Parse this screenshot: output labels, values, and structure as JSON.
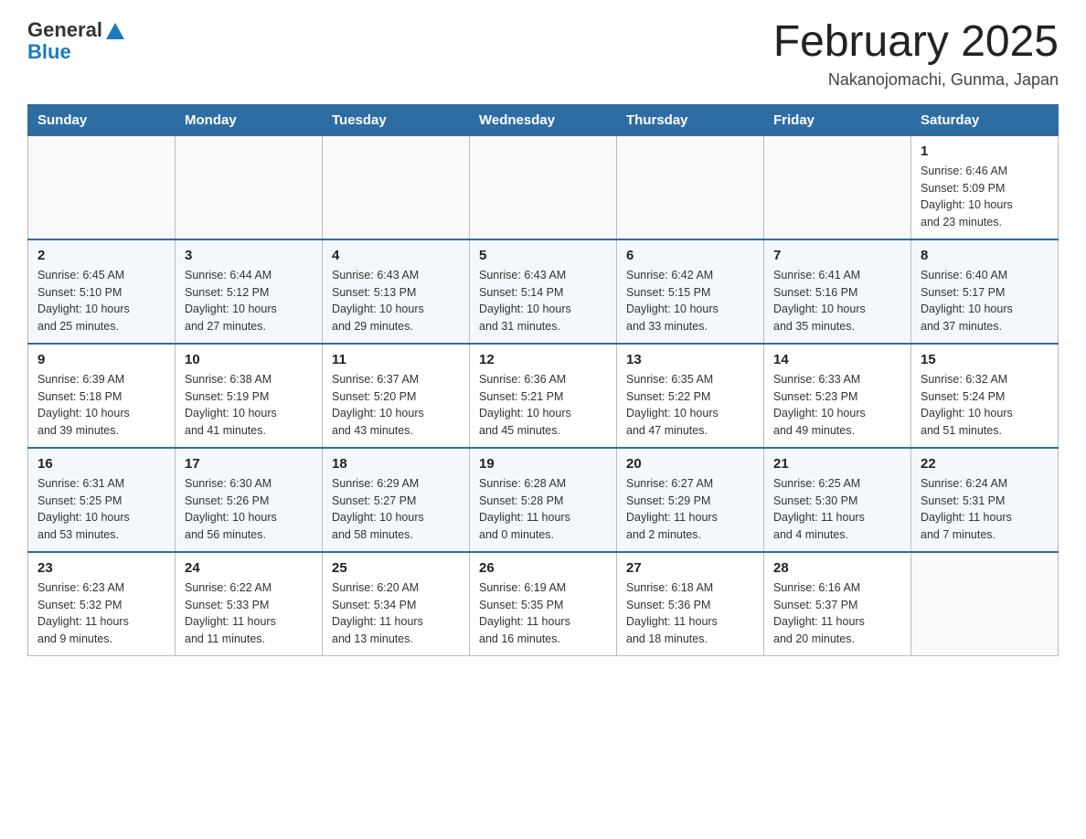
{
  "logo": {
    "general": "General",
    "blue": "Blue"
  },
  "header": {
    "title": "February 2025",
    "location": "Nakanojomachi, Gunma, Japan"
  },
  "weekdays": [
    "Sunday",
    "Monday",
    "Tuesday",
    "Wednesday",
    "Thursday",
    "Friday",
    "Saturday"
  ],
  "weeks": [
    [
      {
        "day": "",
        "info": ""
      },
      {
        "day": "",
        "info": ""
      },
      {
        "day": "",
        "info": ""
      },
      {
        "day": "",
        "info": ""
      },
      {
        "day": "",
        "info": ""
      },
      {
        "day": "",
        "info": ""
      },
      {
        "day": "1",
        "info": "Sunrise: 6:46 AM\nSunset: 5:09 PM\nDaylight: 10 hours\nand 23 minutes."
      }
    ],
    [
      {
        "day": "2",
        "info": "Sunrise: 6:45 AM\nSunset: 5:10 PM\nDaylight: 10 hours\nand 25 minutes."
      },
      {
        "day": "3",
        "info": "Sunrise: 6:44 AM\nSunset: 5:12 PM\nDaylight: 10 hours\nand 27 minutes."
      },
      {
        "day": "4",
        "info": "Sunrise: 6:43 AM\nSunset: 5:13 PM\nDaylight: 10 hours\nand 29 minutes."
      },
      {
        "day": "5",
        "info": "Sunrise: 6:43 AM\nSunset: 5:14 PM\nDaylight: 10 hours\nand 31 minutes."
      },
      {
        "day": "6",
        "info": "Sunrise: 6:42 AM\nSunset: 5:15 PM\nDaylight: 10 hours\nand 33 minutes."
      },
      {
        "day": "7",
        "info": "Sunrise: 6:41 AM\nSunset: 5:16 PM\nDaylight: 10 hours\nand 35 minutes."
      },
      {
        "day": "8",
        "info": "Sunrise: 6:40 AM\nSunset: 5:17 PM\nDaylight: 10 hours\nand 37 minutes."
      }
    ],
    [
      {
        "day": "9",
        "info": "Sunrise: 6:39 AM\nSunset: 5:18 PM\nDaylight: 10 hours\nand 39 minutes."
      },
      {
        "day": "10",
        "info": "Sunrise: 6:38 AM\nSunset: 5:19 PM\nDaylight: 10 hours\nand 41 minutes."
      },
      {
        "day": "11",
        "info": "Sunrise: 6:37 AM\nSunset: 5:20 PM\nDaylight: 10 hours\nand 43 minutes."
      },
      {
        "day": "12",
        "info": "Sunrise: 6:36 AM\nSunset: 5:21 PM\nDaylight: 10 hours\nand 45 minutes."
      },
      {
        "day": "13",
        "info": "Sunrise: 6:35 AM\nSunset: 5:22 PM\nDaylight: 10 hours\nand 47 minutes."
      },
      {
        "day": "14",
        "info": "Sunrise: 6:33 AM\nSunset: 5:23 PM\nDaylight: 10 hours\nand 49 minutes."
      },
      {
        "day": "15",
        "info": "Sunrise: 6:32 AM\nSunset: 5:24 PM\nDaylight: 10 hours\nand 51 minutes."
      }
    ],
    [
      {
        "day": "16",
        "info": "Sunrise: 6:31 AM\nSunset: 5:25 PM\nDaylight: 10 hours\nand 53 minutes."
      },
      {
        "day": "17",
        "info": "Sunrise: 6:30 AM\nSunset: 5:26 PM\nDaylight: 10 hours\nand 56 minutes."
      },
      {
        "day": "18",
        "info": "Sunrise: 6:29 AM\nSunset: 5:27 PM\nDaylight: 10 hours\nand 58 minutes."
      },
      {
        "day": "19",
        "info": "Sunrise: 6:28 AM\nSunset: 5:28 PM\nDaylight: 11 hours\nand 0 minutes."
      },
      {
        "day": "20",
        "info": "Sunrise: 6:27 AM\nSunset: 5:29 PM\nDaylight: 11 hours\nand 2 minutes."
      },
      {
        "day": "21",
        "info": "Sunrise: 6:25 AM\nSunset: 5:30 PM\nDaylight: 11 hours\nand 4 minutes."
      },
      {
        "day": "22",
        "info": "Sunrise: 6:24 AM\nSunset: 5:31 PM\nDaylight: 11 hours\nand 7 minutes."
      }
    ],
    [
      {
        "day": "23",
        "info": "Sunrise: 6:23 AM\nSunset: 5:32 PM\nDaylight: 11 hours\nand 9 minutes."
      },
      {
        "day": "24",
        "info": "Sunrise: 6:22 AM\nSunset: 5:33 PM\nDaylight: 11 hours\nand 11 minutes."
      },
      {
        "day": "25",
        "info": "Sunrise: 6:20 AM\nSunset: 5:34 PM\nDaylight: 11 hours\nand 13 minutes."
      },
      {
        "day": "26",
        "info": "Sunrise: 6:19 AM\nSunset: 5:35 PM\nDaylight: 11 hours\nand 16 minutes."
      },
      {
        "day": "27",
        "info": "Sunrise: 6:18 AM\nSunset: 5:36 PM\nDaylight: 11 hours\nand 18 minutes."
      },
      {
        "day": "28",
        "info": "Sunrise: 6:16 AM\nSunset: 5:37 PM\nDaylight: 11 hours\nand 20 minutes."
      },
      {
        "day": "",
        "info": ""
      }
    ]
  ]
}
